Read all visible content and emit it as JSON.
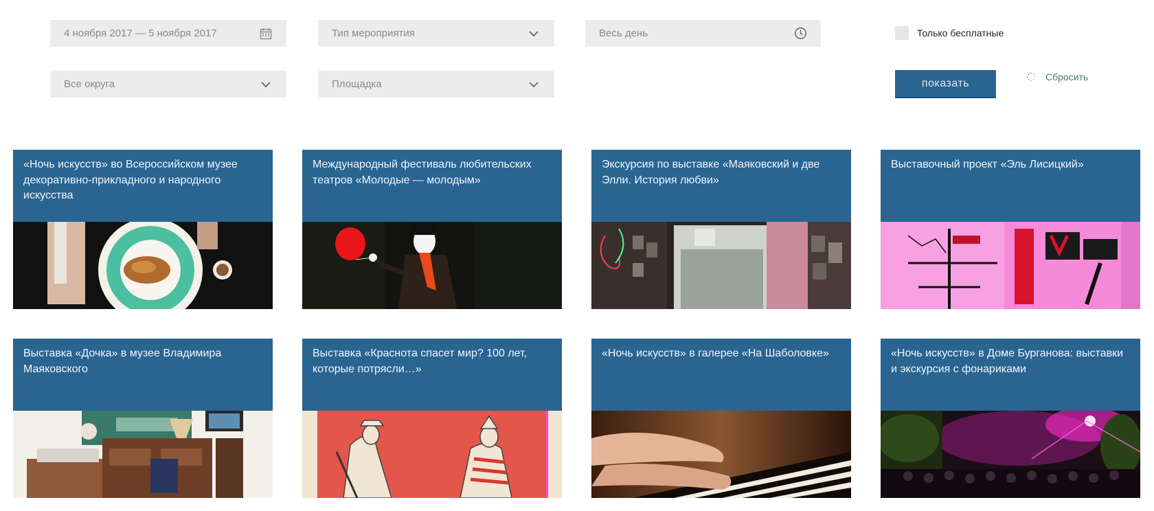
{
  "filters": {
    "date_range": "4 ноября 2017 — 5 ноября 2017",
    "event_type": "Тип мероприятия",
    "time": "Весь день",
    "free_only_label": "Только бесплатные",
    "district": "Все округа",
    "venue": "Площадка",
    "show_button": "показать",
    "reset_label": "Сбросить"
  },
  "cards": [
    {
      "title": "«Ночь искусств» во Всероссийском музее декоративно-прикладного и народного искусства"
    },
    {
      "title": "Международный фестиваль любительских театров «Молодые — молодым»"
    },
    {
      "title": "Экскурсия по выставке «Маяковский и две Элли. История любви»"
    },
    {
      "title": "Выставочный проект «Эль Лисицкий»"
    },
    {
      "title": "Выставка «Дочка» в музее Владимира Маяковского"
    },
    {
      "title": "Выставка «Краснота спасет мир? 100 лет, которые потрясли…»"
    },
    {
      "title": "«Ночь искусств» в галерее «На Шаболовке»"
    },
    {
      "title": "«Ночь искусств» в Доме Бурганова: выставки и экскурсия с фонариками"
    }
  ],
  "colors": {
    "accent": "#2a6592",
    "field_bg": "#ececec"
  },
  "icons": {
    "date": "calendar-icon",
    "dropdown": "chevron-down-icon",
    "time": "clock-icon",
    "reset": "spinner-icon"
  }
}
